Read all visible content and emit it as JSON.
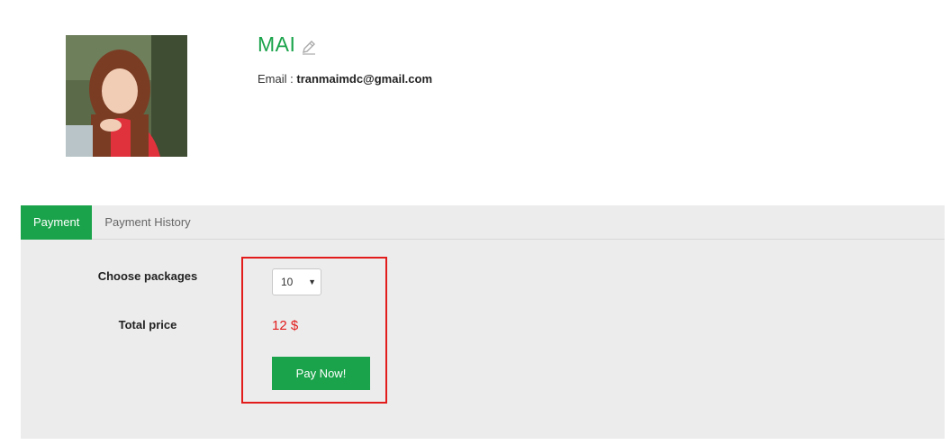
{
  "profile": {
    "name": "MAI",
    "email_label": "Email :",
    "email_value": "tranmaimdc@gmail.com"
  },
  "tabs": [
    {
      "label": "Payment",
      "active": true
    },
    {
      "label": "Payment History",
      "active": false
    }
  ],
  "payment": {
    "packages_label": "Choose packages",
    "packages_value": "10",
    "total_label": "Total price",
    "total_value": "12 $",
    "pay_button": "Pay Now!"
  },
  "colors": {
    "accent_green": "#1aa34a",
    "price_red": "#e21b1b",
    "highlight_red": "#e21b1b",
    "panel_bg": "#ececec"
  },
  "icons": {
    "edit": "pencil-icon",
    "select_caret": "caret-down-icon"
  }
}
